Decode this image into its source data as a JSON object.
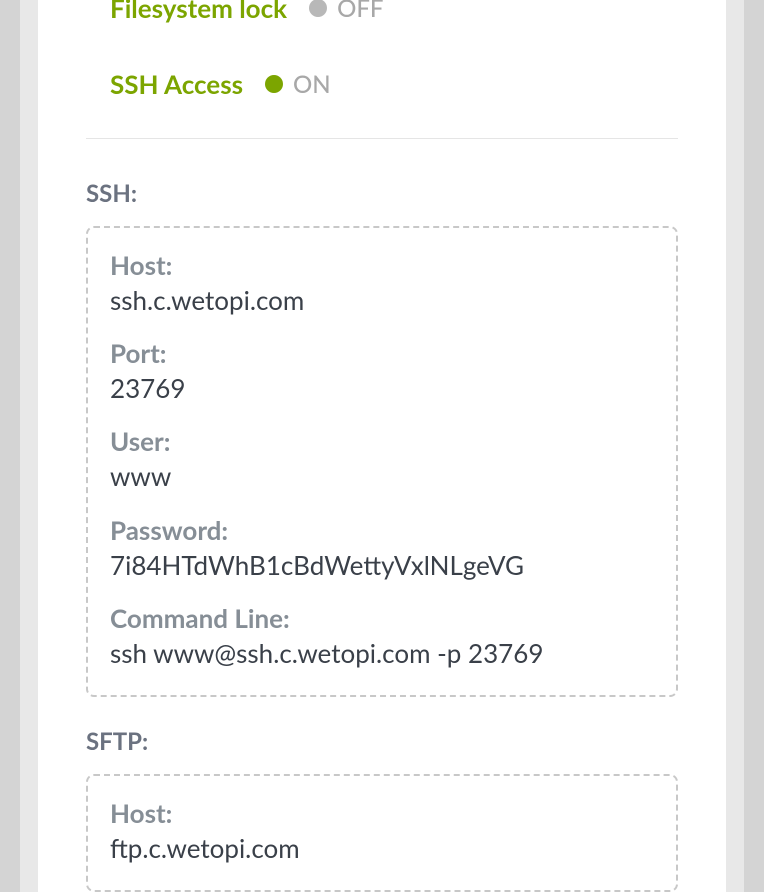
{
  "toggles": {
    "filesystem_lock": {
      "label": "Filesystem lock",
      "state": "OFF"
    },
    "ssh_access": {
      "label": "SSH Access",
      "state": "ON"
    }
  },
  "ssh": {
    "title": "SSH:",
    "fields": {
      "host": {
        "label": "Host:",
        "value": "ssh.c.wetopi.com"
      },
      "port": {
        "label": "Port:",
        "value": "23769"
      },
      "user": {
        "label": "User:",
        "value": "www"
      },
      "password": {
        "label": "Password:",
        "value": "7i84HTdWhB1cBdWettyVxlNLgeVG"
      },
      "command": {
        "label": "Command Line:",
        "value": "ssh www@ssh.c.wetopi.com -p 23769"
      }
    }
  },
  "sftp": {
    "title": "SFTP:",
    "fields": {
      "host": {
        "label": "Host:",
        "value": "ftp.c.wetopi.com"
      }
    }
  }
}
